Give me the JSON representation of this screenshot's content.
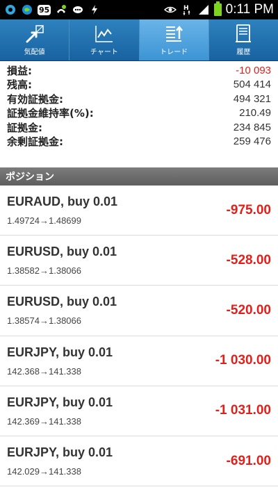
{
  "status_bar": {
    "badge": "95",
    "network": "H",
    "time": "0:11 PM"
  },
  "tabs": [
    {
      "label": "気配値",
      "icon": "quotes-arrows-icon",
      "active": false
    },
    {
      "label": "チャート",
      "icon": "chart-icon",
      "active": false
    },
    {
      "label": "トレード",
      "icon": "trade-icon",
      "active": true
    },
    {
      "label": "履歴",
      "icon": "history-icon",
      "active": false
    }
  ],
  "summary": [
    {
      "label": "損益:",
      "value": "-10 093",
      "negative": true
    },
    {
      "label": "残高:",
      "value": "504 414",
      "negative": false
    },
    {
      "label": "有効証拠金:",
      "value": "494 321",
      "negative": false
    },
    {
      "label": "証拠金維持率(%):",
      "value": "210.49",
      "negative": false
    },
    {
      "label": "証拠金:",
      "value": "234 845",
      "negative": false
    },
    {
      "label": "余剰証拠金:",
      "value": "259 476",
      "negative": false
    }
  ],
  "positions_header": "ポジション",
  "positions": [
    {
      "title": "EURAUD, buy 0.01",
      "prices": "1.49724→1.48699",
      "profit": "-975.00"
    },
    {
      "title": "EURUSD, buy 0.01",
      "prices": "1.38582→1.38066",
      "profit": "-528.00"
    },
    {
      "title": "EURUSD, buy 0.01",
      "prices": "1.38574→1.38066",
      "profit": "-520.00"
    },
    {
      "title": "EURJPY, buy 0.01",
      "prices": "142.368→141.338",
      "profit": "-1 030.00"
    },
    {
      "title": "EURJPY, buy 0.01",
      "prices": "142.369→141.338",
      "profit": "-1 031.00"
    },
    {
      "title": "EURJPY, buy 0.01",
      "prices": "142.029→141.338",
      "profit": "-691.00"
    }
  ],
  "colors": {
    "negative": "#e0201b",
    "tabbar": "#1f6fae",
    "tab_active": "#4ea2dc"
  }
}
